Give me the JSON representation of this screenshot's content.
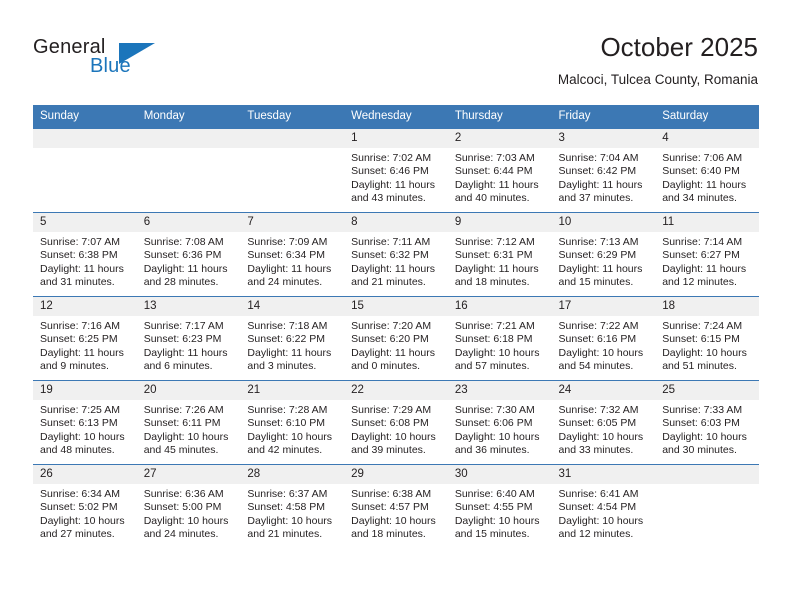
{
  "brand": {
    "name_part1": "General",
    "name_part2": "Blue",
    "logo_icon": "triangle-flag-icon",
    "accent_color": "#1b75bb"
  },
  "header": {
    "title": "October 2025",
    "subtitle": "Malcoci, Tulcea County, Romania"
  },
  "theme": {
    "header_row_bg": "#3c78b4",
    "daynum_bg": "#f0f0f0",
    "text_color": "#231f20"
  },
  "calendar": {
    "weekday_headers": [
      "Sunday",
      "Monday",
      "Tuesday",
      "Wednesday",
      "Thursday",
      "Friday",
      "Saturday"
    ],
    "labels": {
      "sunrise": "Sunrise:",
      "sunset": "Sunset:",
      "daylight": "Daylight:"
    },
    "weeks": [
      [
        {
          "day": "",
          "empty": true,
          "sunrise": "",
          "sunset": "",
          "daylight_line1": "",
          "daylight_line2": ""
        },
        {
          "day": "",
          "empty": true,
          "sunrise": "",
          "sunset": "",
          "daylight_line1": "",
          "daylight_line2": ""
        },
        {
          "day": "",
          "empty": true,
          "sunrise": "",
          "sunset": "",
          "daylight_line1": "",
          "daylight_line2": ""
        },
        {
          "day": "1",
          "sunrise": "Sunrise: 7:02 AM",
          "sunset": "Sunset: 6:46 PM",
          "daylight_line1": "Daylight: 11 hours",
          "daylight_line2": "and 43 minutes."
        },
        {
          "day": "2",
          "sunrise": "Sunrise: 7:03 AM",
          "sunset": "Sunset: 6:44 PM",
          "daylight_line1": "Daylight: 11 hours",
          "daylight_line2": "and 40 minutes."
        },
        {
          "day": "3",
          "sunrise": "Sunrise: 7:04 AM",
          "sunset": "Sunset: 6:42 PM",
          "daylight_line1": "Daylight: 11 hours",
          "daylight_line2": "and 37 minutes."
        },
        {
          "day": "4",
          "sunrise": "Sunrise: 7:06 AM",
          "sunset": "Sunset: 6:40 PM",
          "daylight_line1": "Daylight: 11 hours",
          "daylight_line2": "and 34 minutes."
        }
      ],
      [
        {
          "day": "5",
          "sunrise": "Sunrise: 7:07 AM",
          "sunset": "Sunset: 6:38 PM",
          "daylight_line1": "Daylight: 11 hours",
          "daylight_line2": "and 31 minutes."
        },
        {
          "day": "6",
          "sunrise": "Sunrise: 7:08 AM",
          "sunset": "Sunset: 6:36 PM",
          "daylight_line1": "Daylight: 11 hours",
          "daylight_line2": "and 28 minutes."
        },
        {
          "day": "7",
          "sunrise": "Sunrise: 7:09 AM",
          "sunset": "Sunset: 6:34 PM",
          "daylight_line1": "Daylight: 11 hours",
          "daylight_line2": "and 24 minutes."
        },
        {
          "day": "8",
          "sunrise": "Sunrise: 7:11 AM",
          "sunset": "Sunset: 6:32 PM",
          "daylight_line1": "Daylight: 11 hours",
          "daylight_line2": "and 21 minutes."
        },
        {
          "day": "9",
          "sunrise": "Sunrise: 7:12 AM",
          "sunset": "Sunset: 6:31 PM",
          "daylight_line1": "Daylight: 11 hours",
          "daylight_line2": "and 18 minutes."
        },
        {
          "day": "10",
          "sunrise": "Sunrise: 7:13 AM",
          "sunset": "Sunset: 6:29 PM",
          "daylight_line1": "Daylight: 11 hours",
          "daylight_line2": "and 15 minutes."
        },
        {
          "day": "11",
          "sunrise": "Sunrise: 7:14 AM",
          "sunset": "Sunset: 6:27 PM",
          "daylight_line1": "Daylight: 11 hours",
          "daylight_line2": "and 12 minutes."
        }
      ],
      [
        {
          "day": "12",
          "sunrise": "Sunrise: 7:16 AM",
          "sunset": "Sunset: 6:25 PM",
          "daylight_line1": "Daylight: 11 hours",
          "daylight_line2": "and 9 minutes."
        },
        {
          "day": "13",
          "sunrise": "Sunrise: 7:17 AM",
          "sunset": "Sunset: 6:23 PM",
          "daylight_line1": "Daylight: 11 hours",
          "daylight_line2": "and 6 minutes."
        },
        {
          "day": "14",
          "sunrise": "Sunrise: 7:18 AM",
          "sunset": "Sunset: 6:22 PM",
          "daylight_line1": "Daylight: 11 hours",
          "daylight_line2": "and 3 minutes."
        },
        {
          "day": "15",
          "sunrise": "Sunrise: 7:20 AM",
          "sunset": "Sunset: 6:20 PM",
          "daylight_line1": "Daylight: 11 hours",
          "daylight_line2": "and 0 minutes."
        },
        {
          "day": "16",
          "sunrise": "Sunrise: 7:21 AM",
          "sunset": "Sunset: 6:18 PM",
          "daylight_line1": "Daylight: 10 hours",
          "daylight_line2": "and 57 minutes."
        },
        {
          "day": "17",
          "sunrise": "Sunrise: 7:22 AM",
          "sunset": "Sunset: 6:16 PM",
          "daylight_line1": "Daylight: 10 hours",
          "daylight_line2": "and 54 minutes."
        },
        {
          "day": "18",
          "sunrise": "Sunrise: 7:24 AM",
          "sunset": "Sunset: 6:15 PM",
          "daylight_line1": "Daylight: 10 hours",
          "daylight_line2": "and 51 minutes."
        }
      ],
      [
        {
          "day": "19",
          "sunrise": "Sunrise: 7:25 AM",
          "sunset": "Sunset: 6:13 PM",
          "daylight_line1": "Daylight: 10 hours",
          "daylight_line2": "and 48 minutes."
        },
        {
          "day": "20",
          "sunrise": "Sunrise: 7:26 AM",
          "sunset": "Sunset: 6:11 PM",
          "daylight_line1": "Daylight: 10 hours",
          "daylight_line2": "and 45 minutes."
        },
        {
          "day": "21",
          "sunrise": "Sunrise: 7:28 AM",
          "sunset": "Sunset: 6:10 PM",
          "daylight_line1": "Daylight: 10 hours",
          "daylight_line2": "and 42 minutes."
        },
        {
          "day": "22",
          "sunrise": "Sunrise: 7:29 AM",
          "sunset": "Sunset: 6:08 PM",
          "daylight_line1": "Daylight: 10 hours",
          "daylight_line2": "and 39 minutes."
        },
        {
          "day": "23",
          "sunrise": "Sunrise: 7:30 AM",
          "sunset": "Sunset: 6:06 PM",
          "daylight_line1": "Daylight: 10 hours",
          "daylight_line2": "and 36 minutes."
        },
        {
          "day": "24",
          "sunrise": "Sunrise: 7:32 AM",
          "sunset": "Sunset: 6:05 PM",
          "daylight_line1": "Daylight: 10 hours",
          "daylight_line2": "and 33 minutes."
        },
        {
          "day": "25",
          "sunrise": "Sunrise: 7:33 AM",
          "sunset": "Sunset: 6:03 PM",
          "daylight_line1": "Daylight: 10 hours",
          "daylight_line2": "and 30 minutes."
        }
      ],
      [
        {
          "day": "26",
          "sunrise": "Sunrise: 6:34 AM",
          "sunset": "Sunset: 5:02 PM",
          "daylight_line1": "Daylight: 10 hours",
          "daylight_line2": "and 27 minutes."
        },
        {
          "day": "27",
          "sunrise": "Sunrise: 6:36 AM",
          "sunset": "Sunset: 5:00 PM",
          "daylight_line1": "Daylight: 10 hours",
          "daylight_line2": "and 24 minutes."
        },
        {
          "day": "28",
          "sunrise": "Sunrise: 6:37 AM",
          "sunset": "Sunset: 4:58 PM",
          "daylight_line1": "Daylight: 10 hours",
          "daylight_line2": "and 21 minutes."
        },
        {
          "day": "29",
          "sunrise": "Sunrise: 6:38 AM",
          "sunset": "Sunset: 4:57 PM",
          "daylight_line1": "Daylight: 10 hours",
          "daylight_line2": "and 18 minutes."
        },
        {
          "day": "30",
          "sunrise": "Sunrise: 6:40 AM",
          "sunset": "Sunset: 4:55 PM",
          "daylight_line1": "Daylight: 10 hours",
          "daylight_line2": "and 15 minutes."
        },
        {
          "day": "31",
          "sunrise": "Sunrise: 6:41 AM",
          "sunset": "Sunset: 4:54 PM",
          "daylight_line1": "Daylight: 10 hours",
          "daylight_line2": "and 12 minutes."
        },
        {
          "day": "",
          "empty": true,
          "sunrise": "",
          "sunset": "",
          "daylight_line1": "",
          "daylight_line2": ""
        }
      ]
    ]
  }
}
